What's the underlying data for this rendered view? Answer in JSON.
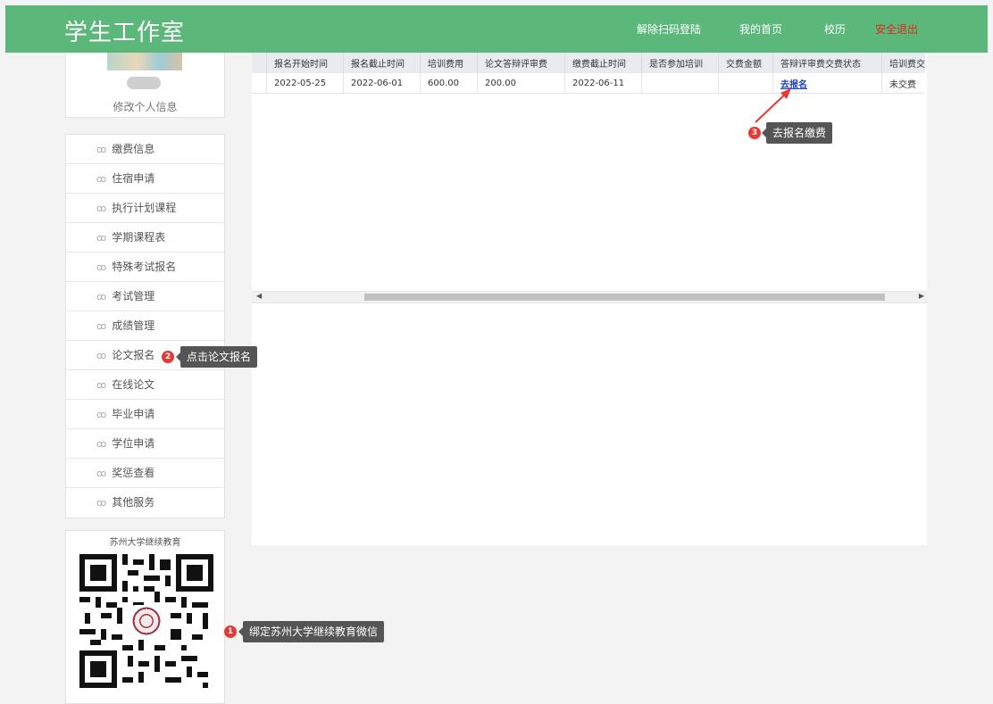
{
  "header": {
    "logo": "学生工作室",
    "nav": [
      "解除扫码登陆",
      "我的首页",
      "校历"
    ],
    "exit": "安全退出"
  },
  "profile": {
    "edit_label": "修改个人信息"
  },
  "menu": [
    {
      "label": "缴费信息"
    },
    {
      "label": "住宿申请"
    },
    {
      "label": "执行计划课程"
    },
    {
      "label": "学期课程表"
    },
    {
      "label": "特殊考试报名"
    },
    {
      "label": "考试管理"
    },
    {
      "label": "成绩管理"
    },
    {
      "label": "论文报名"
    },
    {
      "label": "在线论文"
    },
    {
      "label": "毕业申请"
    },
    {
      "label": "学位申请"
    },
    {
      "label": "奖惩查看"
    },
    {
      "label": "其他服务"
    }
  ],
  "qr": {
    "title": "苏州大学继续教育"
  },
  "table": {
    "headers": [
      "报名开始时间",
      "报名截止时间",
      "培训费用",
      "论文答辩评审费",
      "缴费截止时间",
      "是否参加培训",
      "交费金额",
      "答辩评审费交费状态",
      "培训费交"
    ],
    "row": [
      "2022-05-25",
      "2022-06-01",
      "600.00",
      "200.00",
      "2022-06-11",
      "",
      "",
      "去报名",
      "未交费"
    ]
  },
  "callouts": [
    {
      "num": "1",
      "text": "绑定苏州大学继续教育微信"
    },
    {
      "num": "2",
      "text": "点击论文报名"
    },
    {
      "num": "3",
      "text": "去报名缴费"
    }
  ],
  "colors": {
    "header_bg": "#5cb87a",
    "exit": "#e0281e",
    "badge": "#e53935",
    "link": "#1a3fbf"
  }
}
